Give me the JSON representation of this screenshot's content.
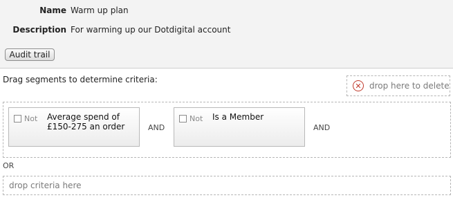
{
  "details": {
    "name_label": "Name",
    "name_value": "Warm up plan",
    "description_label": "Description",
    "description_value": "For warming up our Dotdigital account"
  },
  "audit_button_label": "Audit trail",
  "builder": {
    "instructions": "Drag segments to determine criteria:",
    "delete_zone_label": "drop here to delete",
    "segments": [
      {
        "not_label": "Not",
        "name": "Average spend of £150-275 an order",
        "negated": false
      },
      {
        "not_label": "Not",
        "name": "Is a Member",
        "negated": false
      }
    ],
    "and_label": "AND",
    "or_label": "OR",
    "drop_criteria_label": "drop criteria here"
  },
  "colors": {
    "delete_icon": "#c0392b",
    "header_bg": "#f3f3f3"
  },
  "icons": {
    "delete": "close-circle-icon"
  }
}
